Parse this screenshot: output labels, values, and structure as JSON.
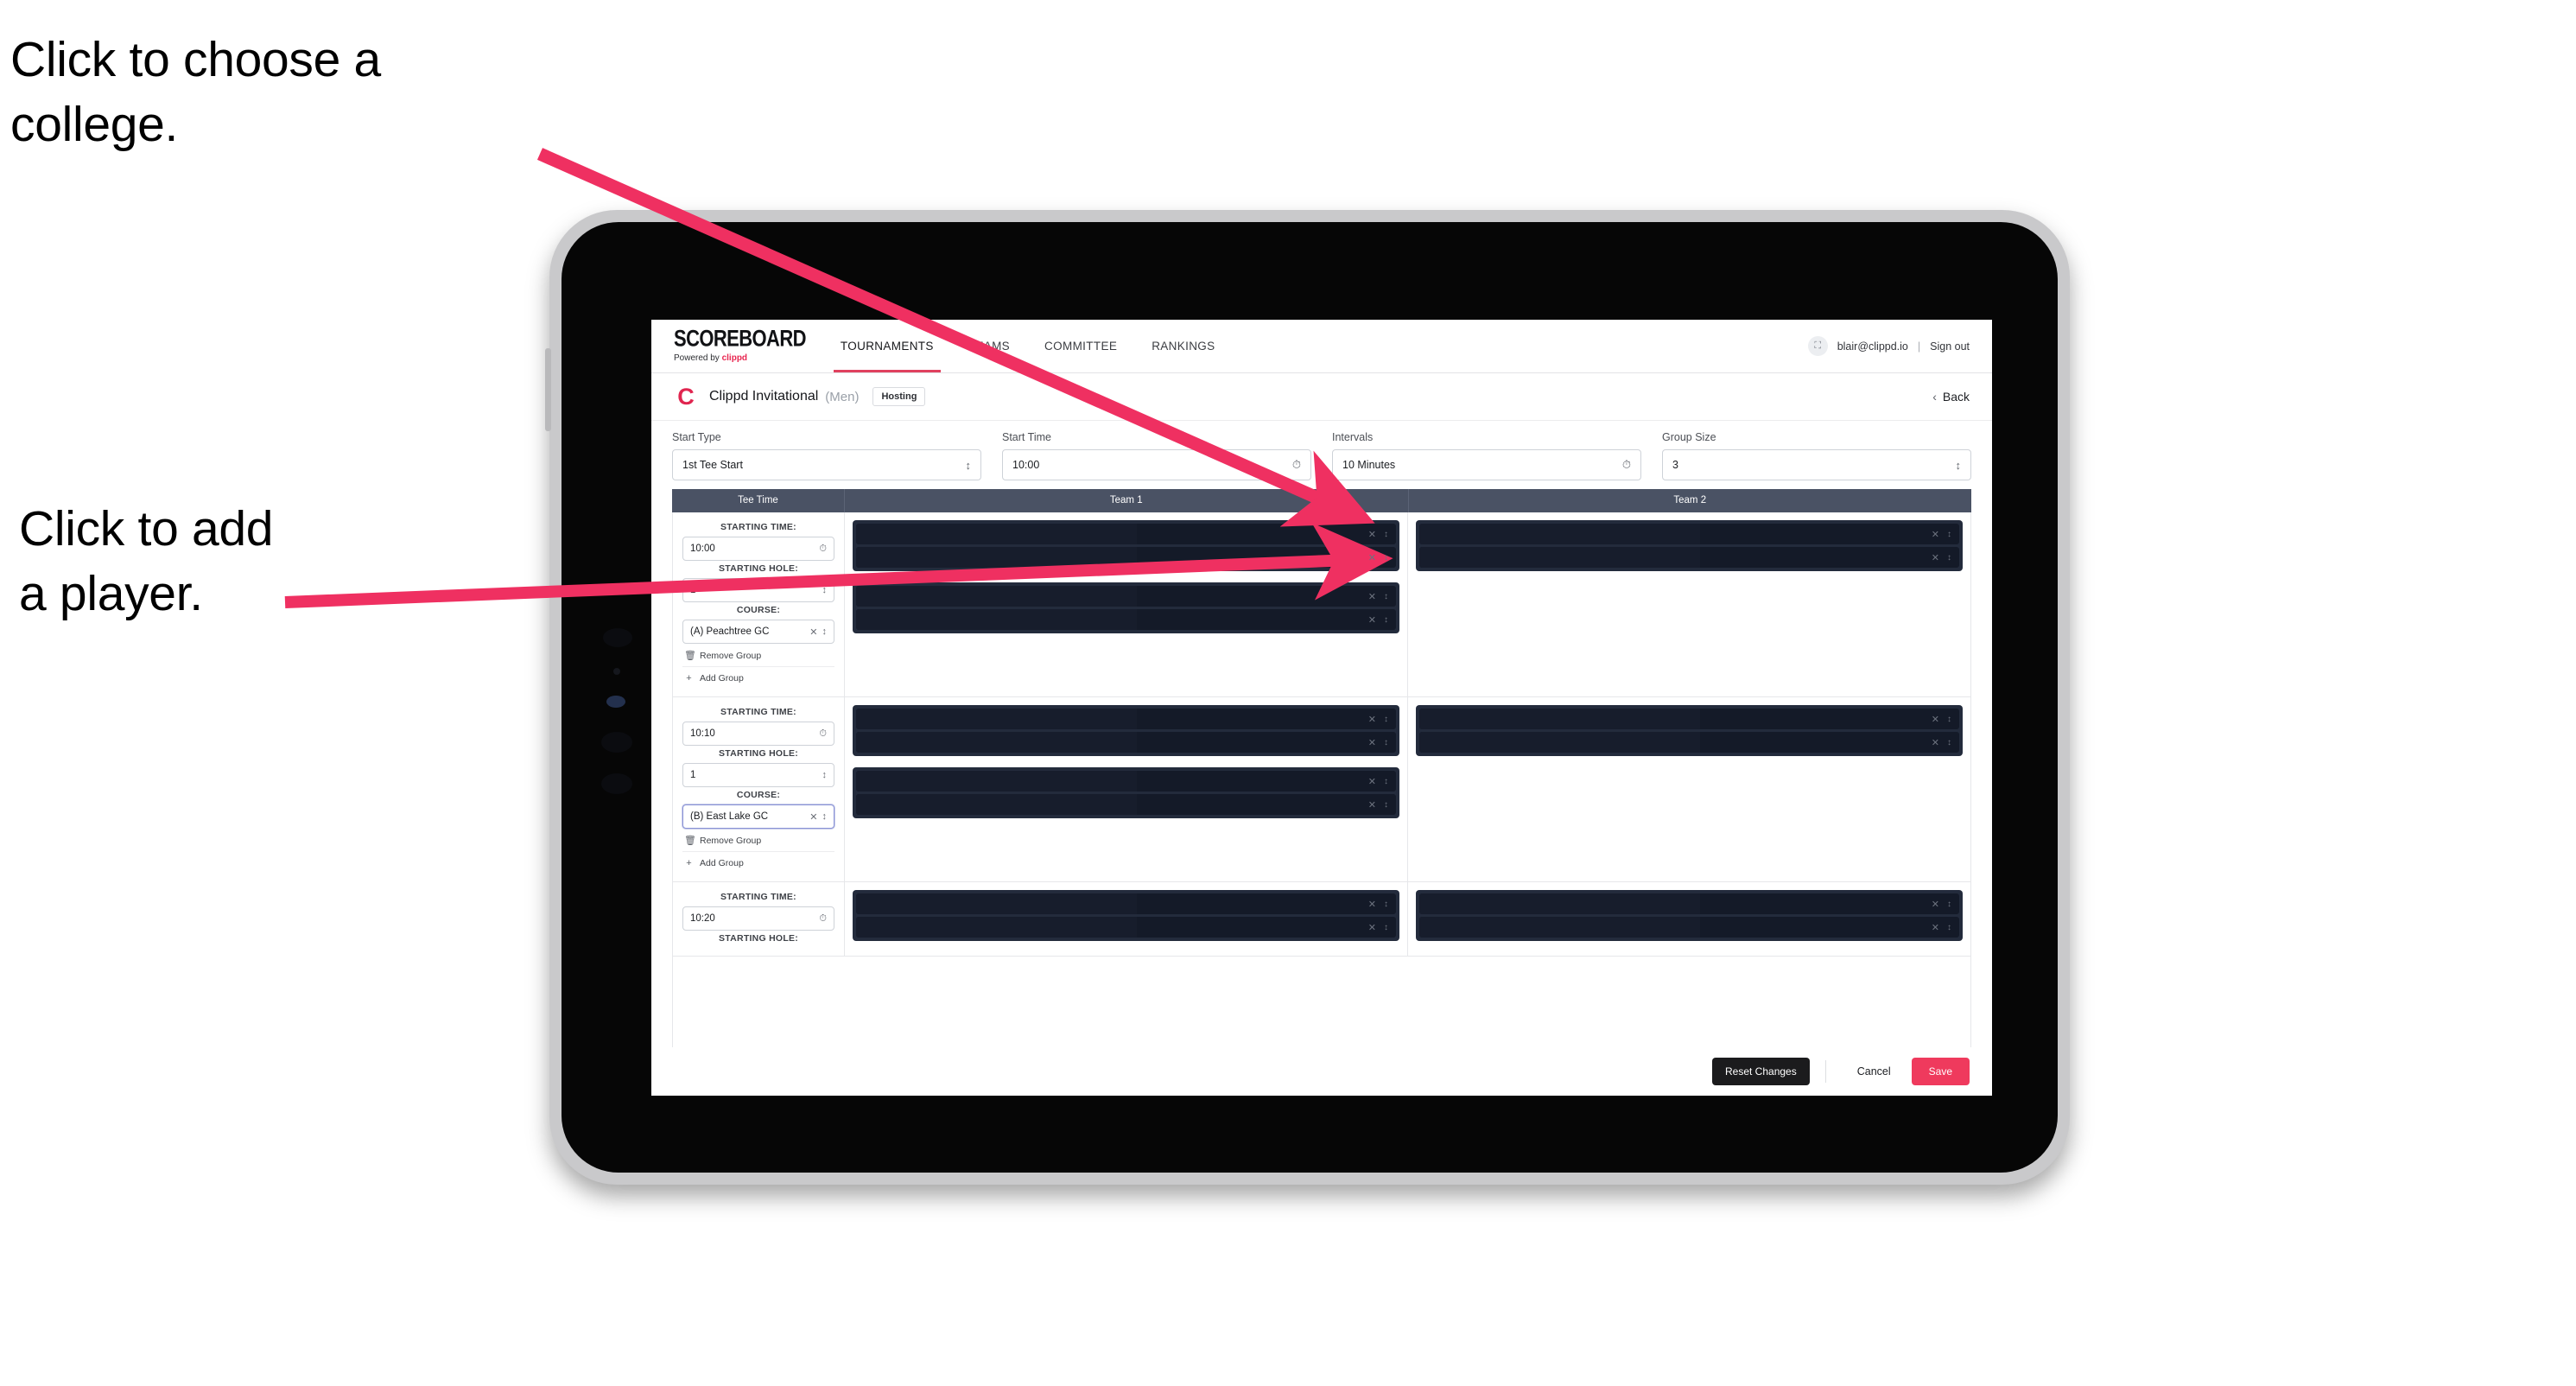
{
  "annotations": {
    "college": "Click to choose a\ncollege.",
    "player": "Click to add\na player."
  },
  "colors": {
    "accent_pink": "#ef3a5d",
    "brand_red": "#e0254f",
    "table_header": "#4a5264",
    "redaction_outer": "#232b3c",
    "redaction_inner": "#141a28"
  },
  "topnav": {
    "brand_word": "SCOREBOARD",
    "brand_sub_prefix": "Powered by ",
    "brand_sub_name": "clippd",
    "tabs": [
      {
        "label": "TOURNAMENTS",
        "active": true
      },
      {
        "label": "TEAMS",
        "active": false
      },
      {
        "label": "COMMITTEE",
        "active": false
      },
      {
        "label": "RANKINGS",
        "active": false
      }
    ],
    "account": {
      "avatar_icon": "user-avatar-icon",
      "email": "blair@clippd.io",
      "separator": "|",
      "sign_out": "Sign out"
    }
  },
  "title_row": {
    "logo_letter": "C",
    "tournament_name": "Clippd Invitational",
    "gender": "(Men)",
    "badge": "Hosting",
    "back_chevron": "‹",
    "back_label": "Back"
  },
  "settings": [
    {
      "label": "Start Type",
      "value": "1st Tee Start",
      "icon": "stepper-icon"
    },
    {
      "label": "Start Time",
      "value": "10:00",
      "icon": "clock-icon"
    },
    {
      "label": "Intervals",
      "value": "10 Minutes",
      "icon": "clock-icon"
    },
    {
      "label": "Group Size",
      "value": "3",
      "icon": "stepper-icon"
    }
  ],
  "table": {
    "headers": [
      "Tee Time",
      "Team 1",
      "Team 2"
    ],
    "labels": {
      "starting_time": "STARTING TIME:",
      "starting_hole": "STARTING HOLE:",
      "course": "COURSE:",
      "remove_group": "Remove Group",
      "add_group": "Add Group",
      "trash_icon": "☐",
      "plus_icon": "+",
      "clock_icon": "◷",
      "stepper_icon": "⇅",
      "clear_icon": "✕"
    },
    "rows": [
      {
        "starting_time": "10:00",
        "starting_hole": "1",
        "course": "(A) Peachtree GC",
        "course_focused": false,
        "team1_stacks": [
          2,
          2
        ],
        "team2_stacks": [
          2
        ]
      },
      {
        "starting_time": "10:10",
        "starting_hole": "1",
        "course": "(B) East Lake GC",
        "course_focused": true,
        "team1_stacks": [
          2,
          2
        ],
        "team2_stacks": [
          2
        ]
      },
      {
        "starting_time": "10:20",
        "starting_hole": "",
        "course": "",
        "course_focused": false,
        "team1_stacks": [
          2
        ],
        "team2_stacks": [
          2
        ]
      }
    ]
  },
  "footer": {
    "reset_label": "Reset Changes",
    "cancel_label": "Cancel",
    "save_label": "Save"
  }
}
